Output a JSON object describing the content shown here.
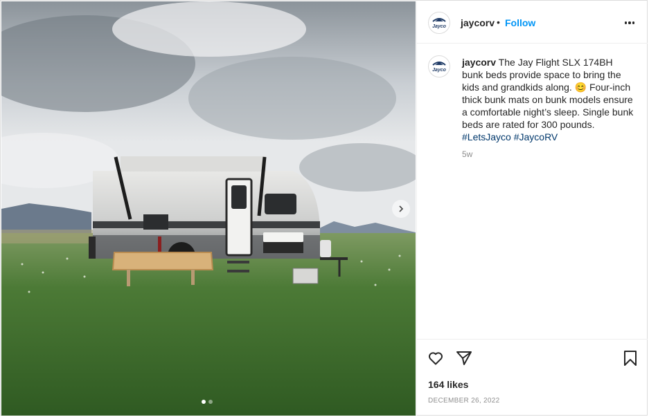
{
  "post": {
    "username": "jaycorv",
    "separator": "•",
    "follow_label": "Follow",
    "caption_user": "jaycorv",
    "caption_text": " The Jay Flight SLX 174BH bunk beds provide space to bring the kids and grandkids along. 😊 Four-inch thick bunk mats on bunk models ensure a comfortable night’s sleep. Single bunk beds are rated for 300 pounds. ",
    "hashtag_1": "#LetsJayco",
    "hashtag_2": "#JaycoRV",
    "time_ago": "5w",
    "likes": "164 likes",
    "date": "DECEMBER 26, 2022",
    "avatar_logo_text": "Jayco",
    "carousel_total": 2,
    "carousel_index": 1
  },
  "icons": {
    "more": "more-options-icon",
    "heart": "heart-icon",
    "share": "paper-plane-icon",
    "bookmark": "bookmark-icon",
    "next": "chevron-right-icon"
  }
}
